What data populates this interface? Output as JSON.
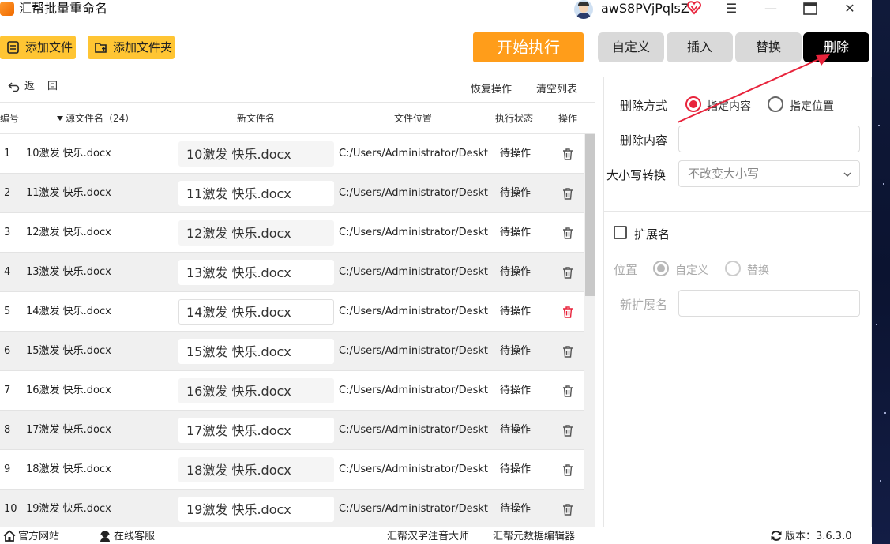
{
  "window": {
    "title": "汇帮批量重命名",
    "user_name": "awS8PVjPqlsZ",
    "menu_icon": "☰",
    "minimize_icon": "—",
    "close_icon": "✕"
  },
  "toolbar": {
    "add_file": "添加文件",
    "add_folder": "添加文件夹",
    "start": "开始执行"
  },
  "tabs": [
    {
      "label": "自定义",
      "active": false
    },
    {
      "label": "插入",
      "active": false
    },
    {
      "label": "替换",
      "active": false
    },
    {
      "label": "删除",
      "active": true
    }
  ],
  "subbar": {
    "undo": "返",
    "back": "回",
    "restore": "恢复操作",
    "clear": "清空列表"
  },
  "table": {
    "headers": {
      "no": "编号",
      "source": "源文件名（24）",
      "new_name": "新文件名",
      "location": "文件位置",
      "status": "执行状态",
      "op": "操作"
    },
    "rows": [
      {
        "no": "1",
        "source": "10激发 快乐.docx",
        "new_name": "10激发 快乐.docx",
        "location": "C:/Users/Administrator/Desktop/",
        "status": "待操作"
      },
      {
        "no": "2",
        "source": "11激发 快乐.docx",
        "new_name": "11激发 快乐.docx",
        "location": "C:/Users/Administrator/Desktop/",
        "status": "待操作"
      },
      {
        "no": "3",
        "source": "12激发 快乐.docx",
        "new_name": "12激发 快乐.docx",
        "location": "C:/Users/Administrator/Desktop/",
        "status": "待操作"
      },
      {
        "no": "4",
        "source": "13激发 快乐.docx",
        "new_name": "13激发 快乐.docx",
        "location": "C:/Users/Administrator/Desktop/",
        "status": "待操作"
      },
      {
        "no": "5",
        "source": "14激发 快乐.docx",
        "new_name": "14激发 快乐.docx",
        "location": "C:/Users/Administrator/Desktop/",
        "status": "待操作"
      },
      {
        "no": "6",
        "source": "15激发 快乐.docx",
        "new_name": "15激发 快乐.docx",
        "location": "C:/Users/Administrator/Desktop/",
        "status": "待操作"
      },
      {
        "no": "7",
        "source": "16激发 快乐.docx",
        "new_name": "16激发 快乐.docx",
        "location": "C:/Users/Administrator/Desktop/",
        "status": "待操作"
      },
      {
        "no": "8",
        "source": "17激发 快乐.docx",
        "new_name": "17激发 快乐.docx",
        "location": "C:/Users/Administrator/Desktop/",
        "status": "待操作"
      },
      {
        "no": "9",
        "source": "18激发 快乐.docx",
        "new_name": "18激发 快乐.docx",
        "location": "C:/Users/Administrator/Desktop/",
        "status": "待操作"
      },
      {
        "no": "10",
        "source": "19激发 快乐.docx",
        "new_name": "19激发 快乐.docx",
        "location": "C:/Users/Administrator/Desktop/",
        "status": "待操作"
      }
    ]
  },
  "panel": {
    "delete_mode_label": "删除方式",
    "mode_content": "指定内容",
    "mode_position": "指定位置",
    "delete_content_label": "删除内容",
    "delete_content_value": "",
    "case_label": "大小写转换",
    "case_value": "不改变大小写",
    "ext_label": "扩展名",
    "ext_position_label": "位置",
    "ext_pos_custom": "自定义",
    "ext_pos_replace": "替换",
    "new_ext_label": "新扩展名",
    "new_ext_value": ""
  },
  "statusbar": {
    "site": "官方网站",
    "service": "在线客服",
    "pinyin": "汇帮汉字注音大师",
    "meta": "汇帮元数据编辑器",
    "version": "版本：3.6.3.0"
  },
  "colors": {
    "accent_red": "#e8243c",
    "button_yellow": "#ffc533",
    "start_orange": "#ff9d1a",
    "active_tab": "#000000"
  }
}
